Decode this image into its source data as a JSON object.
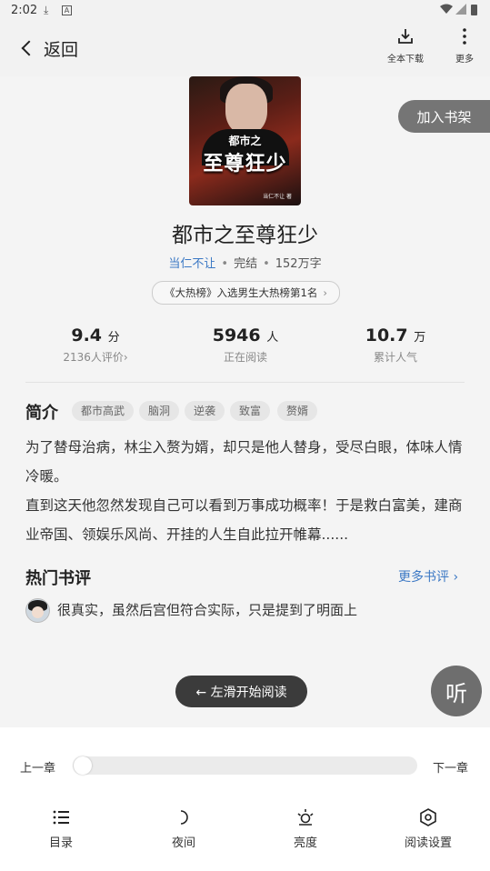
{
  "status_bar": {
    "time": "2:02",
    "left_icons": [
      "download-icon",
      "notification-a-icon"
    ],
    "right_icons": [
      "wifi-icon",
      "signal-icon",
      "battery-icon"
    ]
  },
  "nav": {
    "back_label": "返回",
    "download_label": "全本下载",
    "more_label": "更多"
  },
  "book": {
    "cover_top_text": "都市之",
    "cover_title": "至尊狂少",
    "cover_author": "当仁不让 著",
    "title": "都市之至尊狂少",
    "author": "当仁不让",
    "status": "完结",
    "word_count": "152万字",
    "rank_badge": "《大热榜》入选男生大热榜第1名"
  },
  "add_shelf_label": "加入书架",
  "stats": [
    {
      "value": "9.4",
      "unit": "分",
      "label": "2136人评价",
      "chevron": "›"
    },
    {
      "value": "5946",
      "unit": "人",
      "label": "正在阅读"
    },
    {
      "value": "10.7",
      "unit": "万",
      "label": "累计人气"
    }
  ],
  "intro": {
    "heading": "简介",
    "tags": [
      "都市高武",
      "脑洞",
      "逆袭",
      "致富",
      "赘婿"
    ],
    "paragraph1": "为了替母治病，林尘入赘为婿，却只是他人替身，受尽白眼，体味人情冷暖。",
    "paragraph2": "直到这天他忽然发现自己可以看到万事成功概率！于是救白富美，建商业帝国、领娱乐风尚、开挂的人生自此拉开帷幕......"
  },
  "reviews": {
    "heading": "热门书评",
    "more_label": "更多书评 ›",
    "items": [
      {
        "text": "很真实，虽然后宫但符合实际，只是提到了明面上"
      }
    ]
  },
  "start_read_label": "← 左滑开始阅读",
  "listen_label": "听",
  "reader": {
    "prev_label": "上一章",
    "next_label": "下一章",
    "progress": 0.0
  },
  "toolbar": [
    {
      "label": "目录",
      "icon": "list-icon"
    },
    {
      "label": "夜间",
      "icon": "moon-icon"
    },
    {
      "label": "亮度",
      "icon": "brightness-icon"
    },
    {
      "label": "阅读设置",
      "icon": "settings-icon"
    }
  ]
}
